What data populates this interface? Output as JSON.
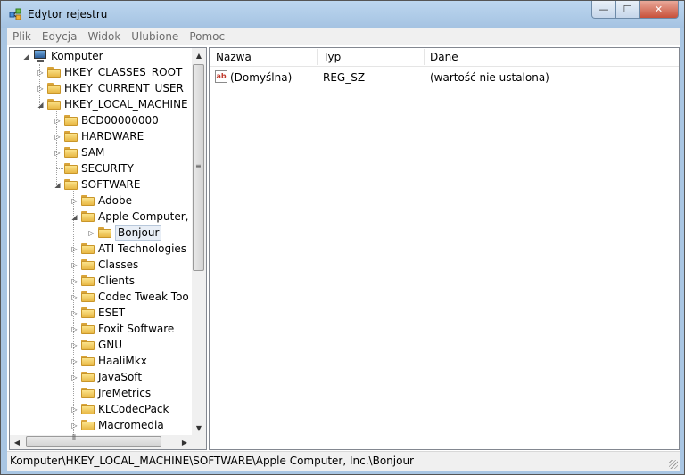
{
  "window": {
    "title": "Edytor rejestru",
    "minimize_glyph": "—",
    "maximize_glyph": "☐",
    "close_glyph": "✕"
  },
  "menu": [
    "Plik",
    "Edycja",
    "Widok",
    "Ulubione",
    "Pomoc"
  ],
  "tree": {
    "root": "Komputer",
    "hkcr": "HKEY_CLASSES_ROOT",
    "hkcu": "HKEY_CURRENT_USER",
    "hklm": "HKEY_LOCAL_MACHINE",
    "hklm_children": [
      "BCD00000000",
      "HARDWARE",
      "SAM",
      "SECURITY",
      "SOFTWARE"
    ],
    "software_children": [
      "Adobe",
      "Apple Computer, I",
      "Bonjour",
      "ATI Technologies",
      "Classes",
      "Clients",
      "Codec Tweak Too",
      "ESET",
      "Foxit Software",
      "GNU",
      "HaaliMkx",
      "JavaSoft",
      "JreMetrics",
      "KLCodecPack",
      "Macromedia"
    ],
    "selected": "Bonjour"
  },
  "list": {
    "columns": [
      "Nazwa",
      "Typ",
      "Dane"
    ],
    "rows": [
      {
        "name": "(Domyślna)",
        "type": "REG_SZ",
        "data": "(wartość nie ustalona)",
        "icon": "string-value-icon"
      }
    ]
  },
  "statusbar": {
    "path": "Komputer\\HKEY_LOCAL_MACHINE\\SOFTWARE\\Apple Computer, Inc.\\Bonjour"
  },
  "colors": {
    "title_bar": "#bcd6ef",
    "close_button": "#c8513b",
    "folder": "#e8b845",
    "selection": "#e8eef6"
  }
}
